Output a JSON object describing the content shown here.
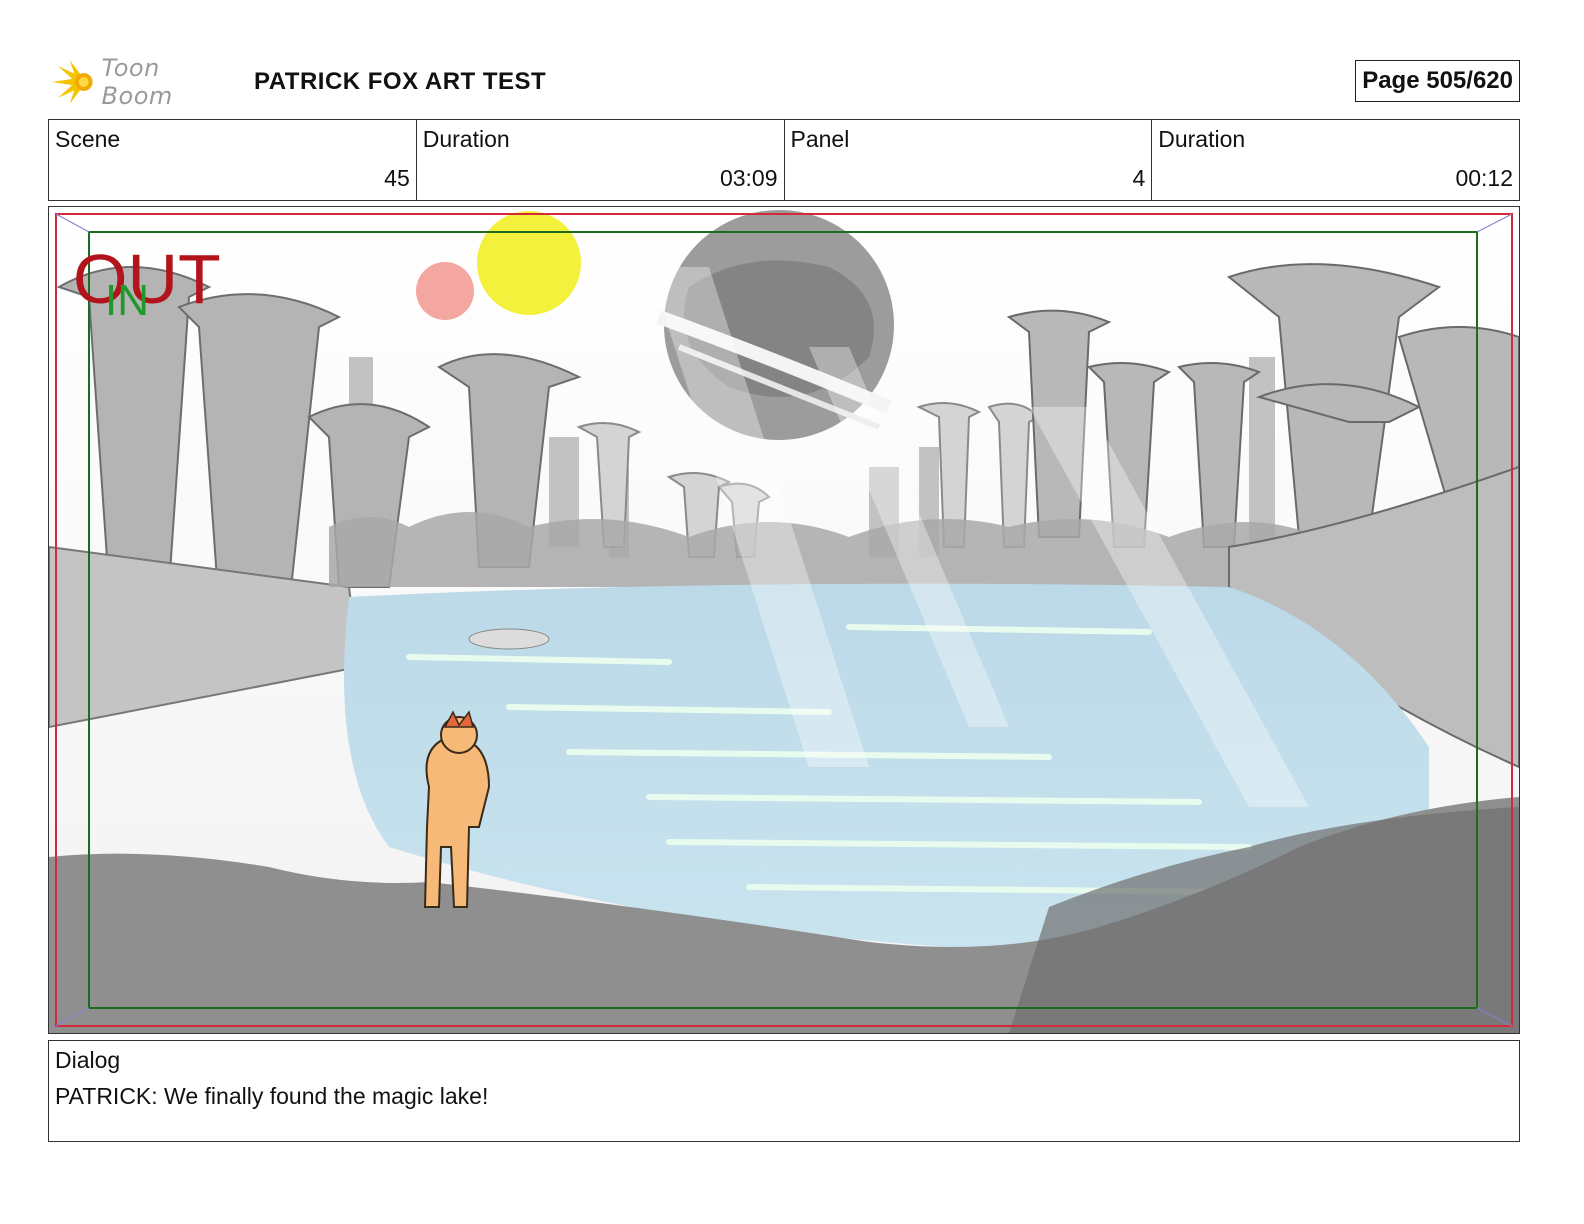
{
  "header": {
    "logo_text": "Toon Boom",
    "title": "PATRICK FOX ART TEST",
    "page_label": "Page 505/620"
  },
  "info": {
    "scene_label": "Scene",
    "scene_value": "45",
    "scene_duration_label": "Duration",
    "scene_duration_value": "03:09",
    "panel_label": "Panel",
    "panel_value": "4",
    "panel_duration_label": "Duration",
    "panel_duration_value": "00:12"
  },
  "panel_image": {
    "out_label": "OUT",
    "in_label": "IN",
    "out_color": "#b3141b",
    "in_color": "#1f9a2a",
    "frame_out_color": "#d22a3a",
    "frame_in_color": "#1e6b1e"
  },
  "dialog": {
    "label": "Dialog",
    "text": "PATRICK: We finally found the magic lake!"
  }
}
